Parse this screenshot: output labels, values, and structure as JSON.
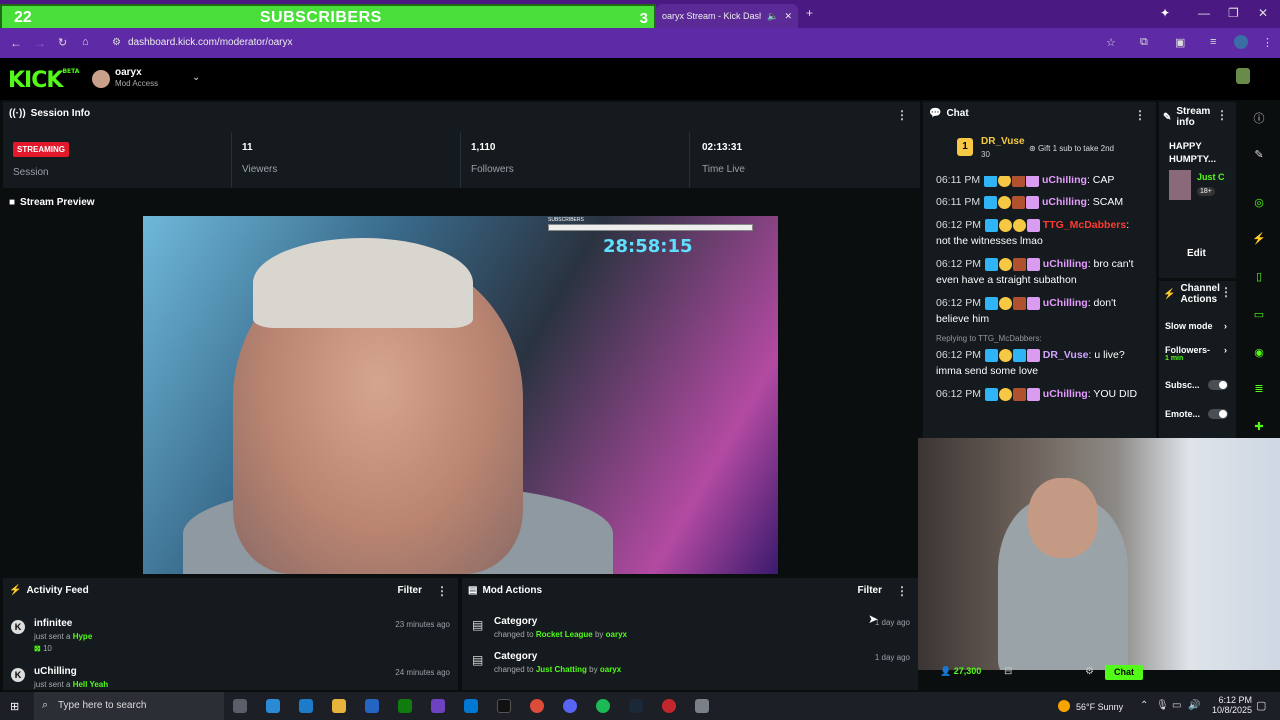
{
  "browser": {
    "tab_title": "oaryx Stream - Kick Dashbo",
    "url": "dashboard.kick.com/moderator/oaryx",
    "new_tab": "+"
  },
  "overlay": {
    "sub_count": "22",
    "sub_label": "SUBSCRIBERS",
    "sub_goal": "3"
  },
  "header": {
    "logo": "KICK",
    "logo_tag": "BETA",
    "username": "oaryx",
    "role": "Mod Access"
  },
  "session": {
    "title": "Session Info",
    "status_badge": "STREAMING",
    "session_label": "Session",
    "stats": [
      {
        "value": "11",
        "label": "Viewers"
      },
      {
        "value": "1,110",
        "label": "Followers"
      },
      {
        "value": "02:13:31",
        "label": "Time Live"
      }
    ]
  },
  "preview": {
    "title": "Stream Preview",
    "timer": "28:58:15",
    "overlay_label": "SUBSCRIBERS"
  },
  "activity": {
    "title": "Activity Feed",
    "filter": "Filter",
    "items": [
      {
        "user": "infinitee",
        "action": "just sent a",
        "item": "Hype",
        "amount": "10",
        "time": "23 minutes ago"
      },
      {
        "user": "uChilling",
        "action": "just sent a",
        "item": "Hell Yeah",
        "time": "24 minutes ago"
      }
    ]
  },
  "mod_actions": {
    "title": "Mod Actions",
    "filter": "Filter",
    "items": [
      {
        "title": "Category",
        "prefix": "changed to",
        "value": "Rocket League",
        "by": "by",
        "user": "oaryx",
        "time": "1 day ago"
      },
      {
        "title": "Category",
        "prefix": "changed to",
        "value": "Just Chatting",
        "by": "by",
        "user": "oaryx",
        "time": "1 day ago"
      }
    ]
  },
  "chat": {
    "title": "Chat",
    "pinned_user": "DR_Vuse",
    "pinned_count": "30",
    "pinned_rank": "1",
    "gift_text": "Gift 1 sub to take 2nd",
    "messages": [
      {
        "time": "06:11 PM",
        "user": "uChilling",
        "text": ": SCAM",
        "color": "uchil"
      },
      {
        "time": "06:12 PM",
        "user": "TTG_McDabbers",
        "text": ": not the witnesses lmao",
        "color": "ttg"
      },
      {
        "time": "06:12 PM",
        "user": "uChilling",
        "text": ": bro can't even have a straight subathon",
        "color": "uchil"
      },
      {
        "time": "06:12 PM",
        "user": "uChilling",
        "text": ": don't believe him",
        "color": "uchil"
      },
      {
        "time": "06:12 PM",
        "user": "DR_Vuse",
        "text": ": u live? imma send some love",
        "color": "vuse",
        "reply": "Replying to TTG_McDabbers:"
      },
      {
        "time": "06:12 PM",
        "user": "uChilling",
        "text": ": YOU DID",
        "color": "uchil"
      }
    ],
    "partial_top": "06:11 PM",
    "partial_top_user": "uChilling",
    "partial_top_text": ": CAP"
  },
  "stream_info": {
    "title": "Stream info",
    "stream_title": "HAPPY HUMPTY...",
    "category": "Just C",
    "rating": "18+",
    "edit": "Edit"
  },
  "channel_actions": {
    "title": "Channel Actions",
    "items": [
      {
        "label": "Slow mode"
      },
      {
        "label": "Followers-",
        "sub": "1 min"
      },
      {
        "label": "Subsc..."
      },
      {
        "label": "Emote..."
      }
    ]
  },
  "webcam": {
    "viewer_count": "27,300",
    "chat_button": "Chat"
  },
  "taskbar": {
    "search_placeholder": "Type here to search",
    "weather": "56°F  Sunny",
    "time": "6:12 PM",
    "date": "10/8/2025"
  },
  "colors": {
    "kick_green": "#53fc18",
    "browser_purple": "#5e2aa5",
    "streaming_red": "#e3192b"
  }
}
